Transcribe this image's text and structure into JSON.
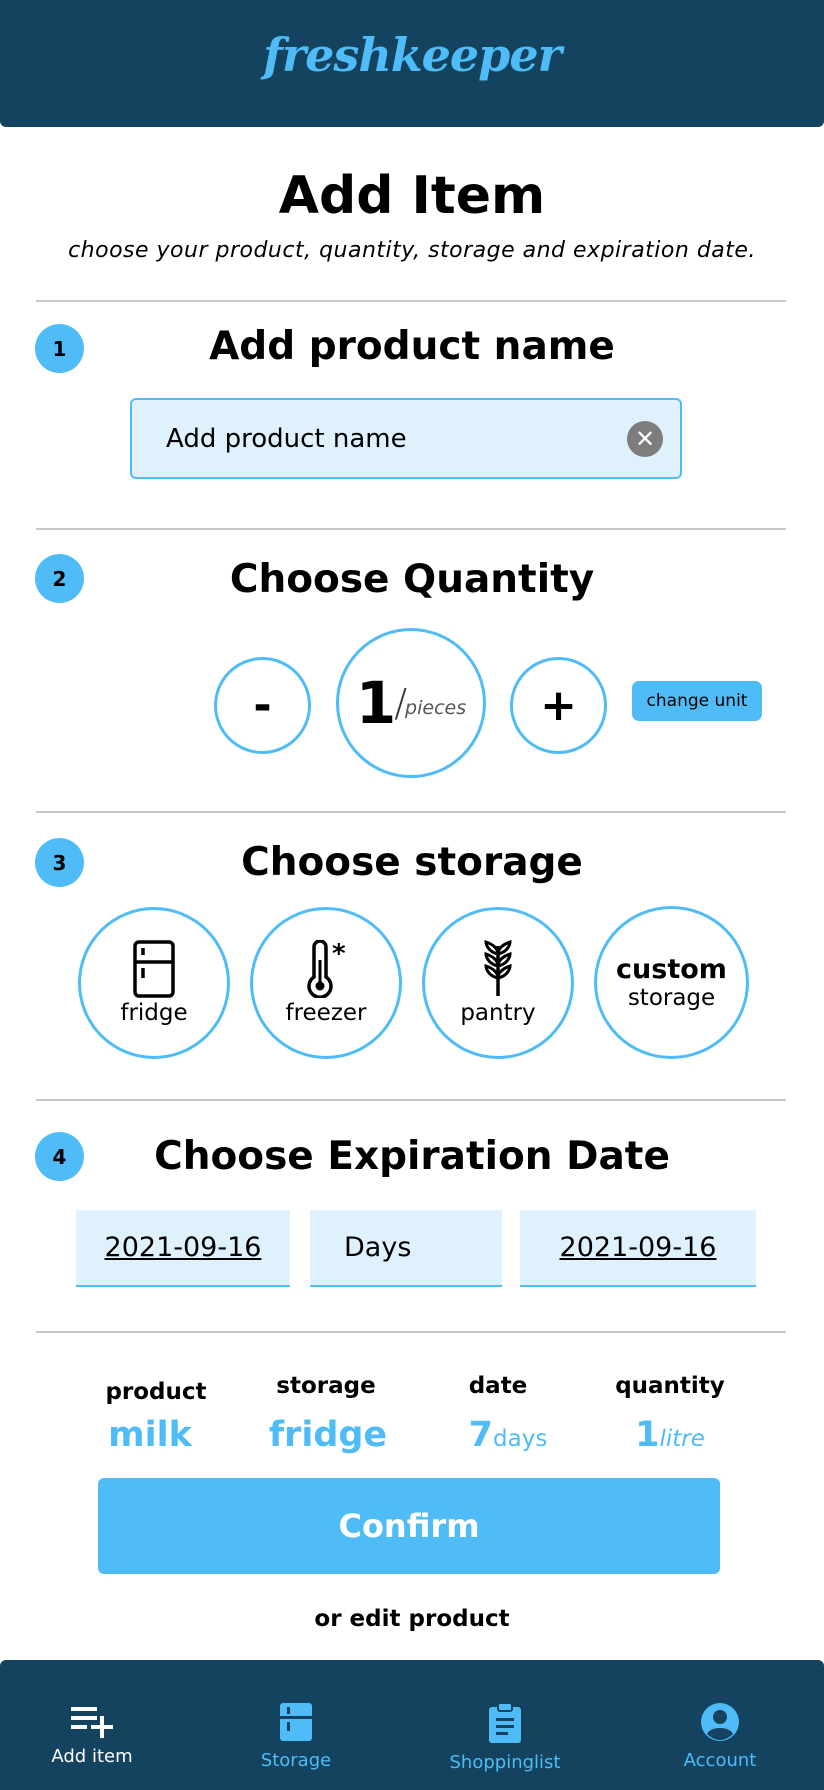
{
  "header": {
    "logo": "freshkeeper"
  },
  "page": {
    "title": "Add Item",
    "subtitle": "choose your product, quantity, storage and expiration date."
  },
  "step1": {
    "number": "1",
    "title": "Add product  name",
    "input_placeholder": "Add product name",
    "input_value": ""
  },
  "step2": {
    "number": "2",
    "title": "Choose Quantity",
    "minus": "-",
    "plus": "+",
    "quantity": "1",
    "slash": "/",
    "unit": "pieces",
    "change_unit": "change unit"
  },
  "step3": {
    "number": "3",
    "title": "Choose storage",
    "options": [
      {
        "label": "fridge",
        "icon": "fridge-icon"
      },
      {
        "label": "freezer",
        "icon": "thermometer-snow-icon"
      },
      {
        "label": "pantry",
        "icon": "wheat-icon"
      },
      {
        "label_bold": "custom",
        "label": "storage"
      }
    ]
  },
  "step4": {
    "number": "4",
    "title": "Choose Expiration Date",
    "date_from": "2021-09-16",
    "days_placeholder": "Days",
    "date_to": "2021-09-16"
  },
  "summary": {
    "product_label": "product",
    "product_value": "milk",
    "storage_label": "storage",
    "storage_value": "fridge",
    "date_label": "date",
    "date_value": "7",
    "date_unit": "days",
    "quantity_label": "quantity",
    "quantity_value": "1",
    "quantity_unit": "litre"
  },
  "actions": {
    "confirm": "Confirm",
    "edit": "or edit product"
  },
  "nav": [
    {
      "label": "Add item",
      "icon": "add-list-icon",
      "active": true
    },
    {
      "label": "Storage",
      "icon": "fridge-icon",
      "active": false
    },
    {
      "label": "Shoppinglist",
      "icon": "clipboard-icon",
      "active": false
    },
    {
      "label": "Account",
      "icon": "account-icon",
      "active": false
    }
  ],
  "colors": {
    "primary": "#4fbcf7",
    "header_bg": "#13435f",
    "field_bg": "#dff1fd",
    "divider": "#c8c8c8"
  }
}
